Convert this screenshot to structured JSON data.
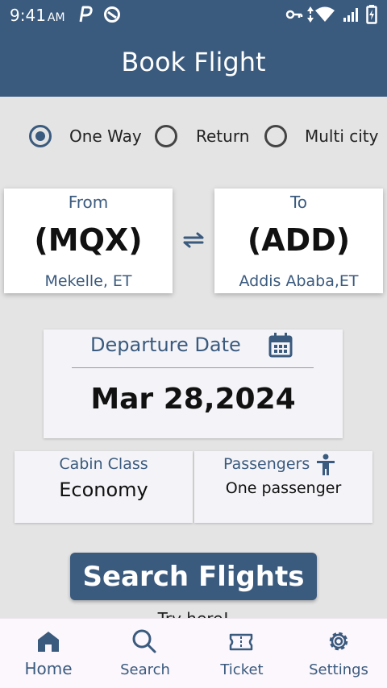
{
  "status_bar": {
    "time": "9:41",
    "ampm": "AM",
    "icons": [
      "parking-icon",
      "do-not-disturb-icon",
      "key-icon",
      "data-arrows-icon",
      "wifi-icon",
      "signal-icon",
      "battery-charging-icon"
    ]
  },
  "app_bar": {
    "title": "Book Flight"
  },
  "trip_type": {
    "selected": "One Way",
    "options": [
      {
        "label": "One Way",
        "selected": true
      },
      {
        "label": "Return",
        "selected": false
      },
      {
        "label": "Multi city",
        "selected": false
      }
    ]
  },
  "route": {
    "from": {
      "caption": "From",
      "code": "(MQX)",
      "city": "Mekelle, ET"
    },
    "to": {
      "caption": "To",
      "code": "(ADD)",
      "city": "Addis Ababa,ET"
    },
    "swap_icon": "swap-arrows-icon"
  },
  "departure": {
    "caption": "Departure Date",
    "value": "Mar 28,2024",
    "icon": "calendar-icon"
  },
  "cabin": {
    "caption": "Cabin Class",
    "value": "Economy"
  },
  "passengers": {
    "caption": "Passengers",
    "value": "One passenger",
    "icon": "person-icon"
  },
  "search_button": {
    "label": "Search Flights"
  },
  "hint": {
    "text": "Try here!"
  },
  "bottom_nav": {
    "active": "Home",
    "items": [
      {
        "label": "Home",
        "icon": "home-icon"
      },
      {
        "label": "Search",
        "icon": "search-icon"
      },
      {
        "label": "Ticket",
        "icon": "ticket-icon"
      },
      {
        "label": "Settings",
        "icon": "gear-icon"
      }
    ]
  },
  "colors": {
    "primary": "#3a5a7e",
    "background": "#e4e4e4",
    "card": "#ffffff",
    "nav_background": "#fcf7fc"
  }
}
